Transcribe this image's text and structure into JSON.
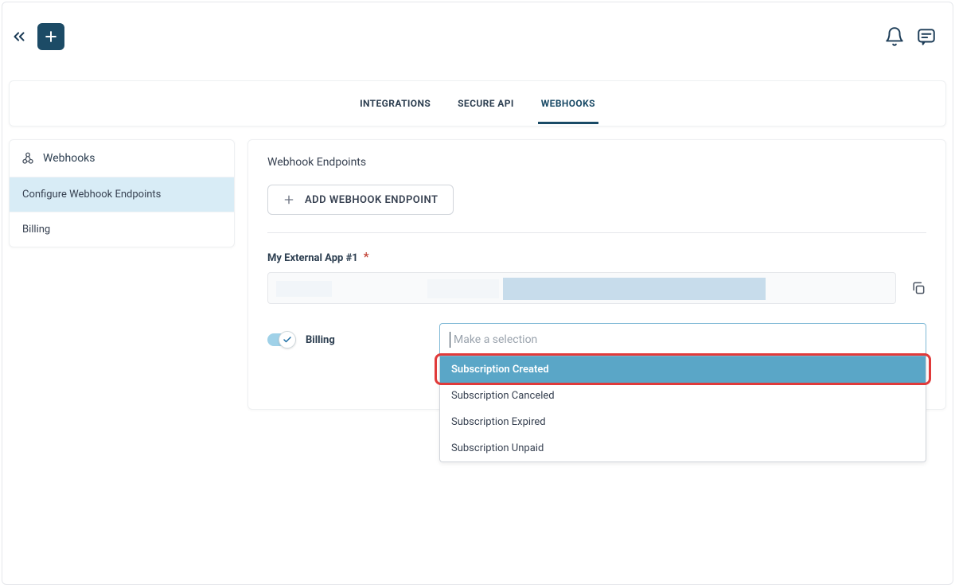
{
  "tabs": {
    "integrations": "INTEGRATIONS",
    "secure_api": "SECURE API",
    "webhooks": "WEBHOOKS"
  },
  "sidebar": {
    "title": "Webhooks",
    "items": [
      {
        "label": "Configure Webhook Endpoints"
      },
      {
        "label": "Billing"
      }
    ]
  },
  "main": {
    "title": "Webhook Endpoints",
    "add_button": "ADD WEBHOOK ENDPOINT",
    "endpoint_label": "My External App #1",
    "toggle_label": "Billing",
    "select_placeholder": "Make a selection",
    "dropdown_options": [
      "Subscription Created",
      "Subscription Canceled",
      "Subscription Expired",
      "Subscription Unpaid"
    ]
  }
}
